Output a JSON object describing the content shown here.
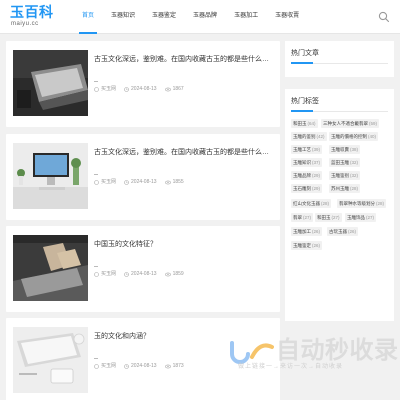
{
  "header": {
    "logo_title": "玉百科",
    "logo_sub": "maiyu.cc",
    "nav": [
      {
        "label": "首页",
        "active": true
      },
      {
        "label": "玉器知识",
        "active": false
      },
      {
        "label": "玉器鉴定",
        "active": false
      },
      {
        "label": "玉器品牌",
        "active": false
      },
      {
        "label": "玉器加工",
        "active": false
      },
      {
        "label": "玉器収賣",
        "active": false
      }
    ],
    "search_icon": "search-icon"
  },
  "posts": [
    {
      "title": "古玉文化深远，鉴别难。在国内收藏古玉的都是些什么样的高...",
      "author": "买玉网",
      "date": "2024-08-13",
      "views": "1867",
      "thumb": "laptop-dark"
    },
    {
      "title": "古玉文化深远，鉴别难。在国内收藏古玉的都是些什么样的高...",
      "author": "买玉网",
      "date": "2024-08-13",
      "views": "1855",
      "thumb": "desk-imac"
    },
    {
      "title": "中国玉的文化特征？",
      "author": "买玉网",
      "date": "2024-08-13",
      "views": "1859",
      "thumb": "typing-laptop"
    },
    {
      "title": "玉的文化和内涵？",
      "author": "买玉网",
      "date": "2024-08-13",
      "views": "1873",
      "thumb": "keyboard-desk"
    }
  ],
  "sidebar": {
    "hot_articles_title": "热门文章",
    "hot_tags_title": "热门标签",
    "tags": [
      {
        "name": "和田玉",
        "count": "(64)"
      },
      {
        "name": "三种女人不適合戴翡翠",
        "count": "(59)"
      },
      {
        "name": "玉雕的鉴别",
        "count": "(42)"
      },
      {
        "name": "玉雕的價格的控制",
        "count": "(40)"
      },
      {
        "name": "玉雕工艺",
        "count": "(39)"
      },
      {
        "name": "玉雕収賣",
        "count": "(38)"
      },
      {
        "name": "玉雕知识",
        "count": "(37)"
      },
      {
        "name": "蓝田玉雕",
        "count": "(32)"
      },
      {
        "name": "玉雕品牌",
        "count": "(29)"
      },
      {
        "name": "玉雕鉴别",
        "count": "(32)"
      },
      {
        "name": "玉石雕刻",
        "count": "(29)"
      },
      {
        "name": "苏州玉雕",
        "count": "(28)"
      },
      {
        "name": "红山文化玉器",
        "count": "(28)"
      },
      {
        "name": "翡翠种水等级划分",
        "count": "(28)"
      },
      {
        "name": "翡翠",
        "count": "(27)"
      },
      {
        "name": "和田玉",
        "count": "(27)"
      },
      {
        "name": "玉雕饰品",
        "count": "(27)"
      },
      {
        "name": "玉雕加工",
        "count": "(26)"
      },
      {
        "name": "古玩玉器",
        "count": "(26)"
      },
      {
        "name": "玉雕鉴定",
        "count": "(26)"
      }
    ]
  },
  "watermark": {
    "text": "自动秒收录",
    "sub": "做上链接一→来访一次→自动收录"
  },
  "colors": {
    "accent": "#2196f3",
    "background": "#f1f1f1",
    "card": "#ffffff",
    "meta": "#999999"
  }
}
